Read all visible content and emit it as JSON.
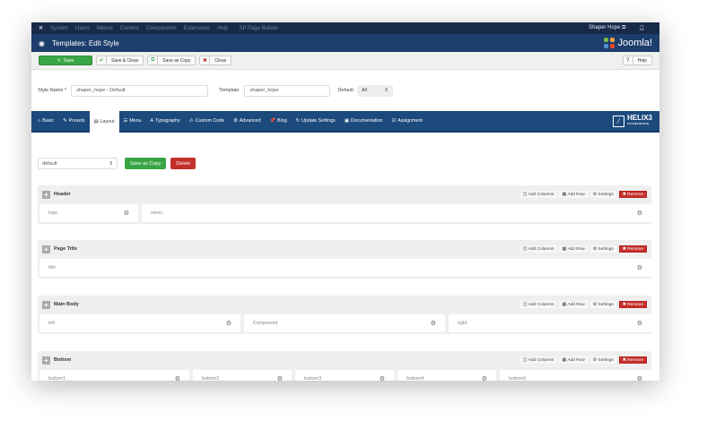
{
  "topnav": {
    "items": [
      "System",
      "Users",
      "Menus",
      "Content",
      "Components",
      "Extensions",
      "Help",
      "SP Page Builder"
    ],
    "user": "Shaper Hope ⧉",
    "user_icon": "user-icon"
  },
  "header": {
    "title": "Templates: Edit Style",
    "brand": "Joomla!"
  },
  "toolbar": {
    "save": "Save",
    "save_close": "Save & Close",
    "save_copy": "Save as Copy",
    "close": "Close",
    "help": "Help"
  },
  "form": {
    "style_name_label": "Style Name *",
    "style_name_value": "shaper_hope - Default",
    "template_label": "Template",
    "template_value": "shaper_hope",
    "default_label": "Default",
    "default_value": "All"
  },
  "tabs": [
    {
      "icon": "⌂",
      "label": "Basic"
    },
    {
      "icon": "✎",
      "label": "Presets"
    },
    {
      "icon": "▤",
      "label": "Layout"
    },
    {
      "icon": "☰",
      "label": "Menu"
    },
    {
      "icon": "A",
      "label": "Typography"
    },
    {
      "icon": "‹/›",
      "label": "Custom Code"
    },
    {
      "icon": "⚙",
      "label": "Advanced"
    },
    {
      "icon": "📌",
      "label": "Blog"
    },
    {
      "icon": "↻",
      "label": "Update Settings"
    },
    {
      "icon": "▣",
      "label": "Documentation"
    },
    {
      "icon": "☑",
      "label": "Assignment"
    }
  ],
  "helix": {
    "name": "HELIX3",
    "sub": "FRAMEWORK"
  },
  "layout": {
    "selected": "default",
    "save_copy": "Save as Copy",
    "delete": "Delete"
  },
  "row_actions": {
    "add_columns": "Add Columns",
    "add_row": "Add Row",
    "settings": "Settings",
    "remove": "Remove"
  },
  "sections": [
    {
      "title": "Header",
      "columns": [
        "logo",
        "menu"
      ]
    },
    {
      "title": "Page Title",
      "columns": [
        "title"
      ]
    },
    {
      "title": "Main Body",
      "columns": [
        "left",
        "Component",
        "right"
      ]
    },
    {
      "title": "Bottom",
      "columns": [
        "bottom1",
        "bottom2",
        "bottom3",
        "bottom4",
        "bottom5"
      ]
    }
  ],
  "colors": {
    "nav": "#182a4a",
    "header": "#1d3d6c",
    "tabs": "#1c4a7c",
    "green": "#3aa545",
    "red": "#c4312b"
  }
}
